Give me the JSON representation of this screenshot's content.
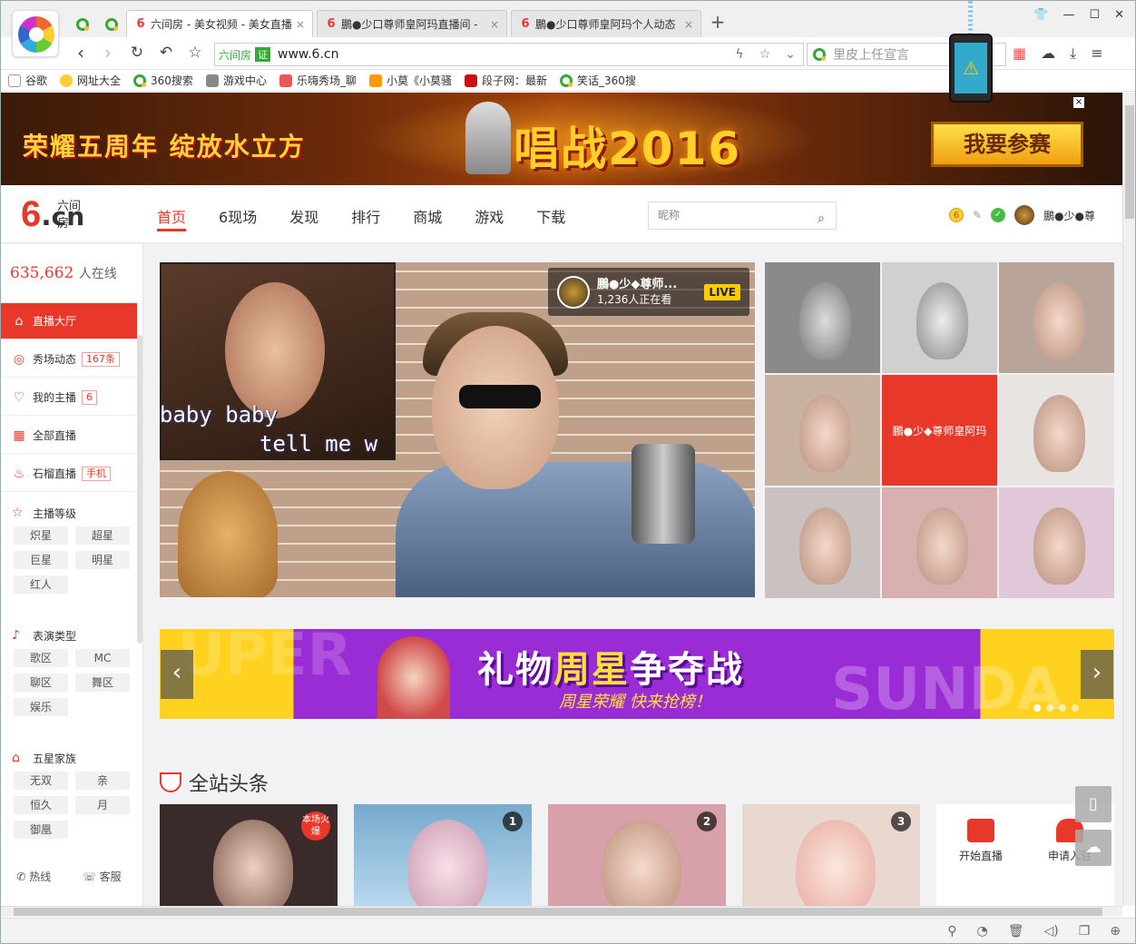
{
  "browser": {
    "tabs": [
      {
        "title": "六间房 - 美女视频 - 美女直播",
        "active": true
      },
      {
        "title": "鵬●少口尊师皇阿玛直播间 - ",
        "active": false
      },
      {
        "title": "鵬●少口尊师皇阿玛个人动态",
        "active": false
      }
    ],
    "new_tab": "+",
    "address": {
      "site_label": "六间房",
      "cert": "证",
      "url": "www.6.cn"
    },
    "search_placeholder": "里皮上任宣言",
    "bookmarks": [
      "谷歌",
      "网址大全",
      "360搜索",
      "游戏中心",
      "乐嗨秀场_聊",
      "小莫《小莫骚",
      "段子网：最新",
      "笑话_360搜"
    ]
  },
  "banner": {
    "left_text": "荣耀五周年 绽放水立方",
    "center_text": "唱战2016",
    "button": "我要参赛",
    "close": "×"
  },
  "header": {
    "logo_small": "六间房",
    "logo_big": "6",
    "logo_dot": ".",
    "logo_cn": "cn",
    "nav": [
      "首页",
      "6现场",
      "发现",
      "排行",
      "商城",
      "游戏",
      "下载"
    ],
    "search_placeholder": "昵称",
    "username": "鵬●少●尊"
  },
  "sidebar": {
    "online_count": "635,662",
    "online_label": "人在线",
    "items": [
      {
        "label": "直播大厅",
        "badge": ""
      },
      {
        "label": "秀场动态",
        "badge": "167条"
      },
      {
        "label": "我的主播",
        "badge": "6"
      },
      {
        "label": "全部直播",
        "badge": ""
      },
      {
        "label": "石榴直播",
        "badge": "手机"
      }
    ],
    "groups": [
      {
        "title": "主播等级",
        "chips": [
          "炽星",
          "超星",
          "巨星",
          "明星",
          "红人"
        ]
      },
      {
        "title": "表演类型",
        "chips": [
          "歌区",
          "MC",
          "聊区",
          "舞区",
          "娱乐"
        ]
      },
      {
        "title": "五星家族",
        "chips": [
          "无双",
          "亲",
          "恒久",
          "月",
          "御凰"
        ]
      }
    ],
    "footer": [
      "热线",
      "客服"
    ]
  },
  "player": {
    "lyric_1": "baby baby",
    "lyric_2": "tell me w",
    "anchor_name": "鵬●少◆尊师...",
    "viewers": "1,236人正在看",
    "live_tag": "LIVE"
  },
  "grid_center_label": "鵬●少◆尊师皇阿玛",
  "promo": {
    "bg_text_1": "UPER",
    "bg_text_2": "SUNDA",
    "title_a": "礼物",
    "title_b": "周星",
    "title_c": "争夺战",
    "subtitle": "周星荣耀 快来抢榜！",
    "prev": "‹",
    "next": "›"
  },
  "headlines": {
    "title": "全站头条",
    "cards": [
      {
        "rank": "",
        "hot": "本场火爆"
      },
      {
        "rank": "1",
        "hot": ""
      },
      {
        "rank": "2",
        "hot": ""
      },
      {
        "rank": "3",
        "hot": ""
      }
    ],
    "actions": [
      "开始直播",
      "申请入驻"
    ]
  },
  "colors": {
    "accent": "#e8382a",
    "promo_purple": "#9a2cd6",
    "promo_yellow": "#ffd21f"
  }
}
